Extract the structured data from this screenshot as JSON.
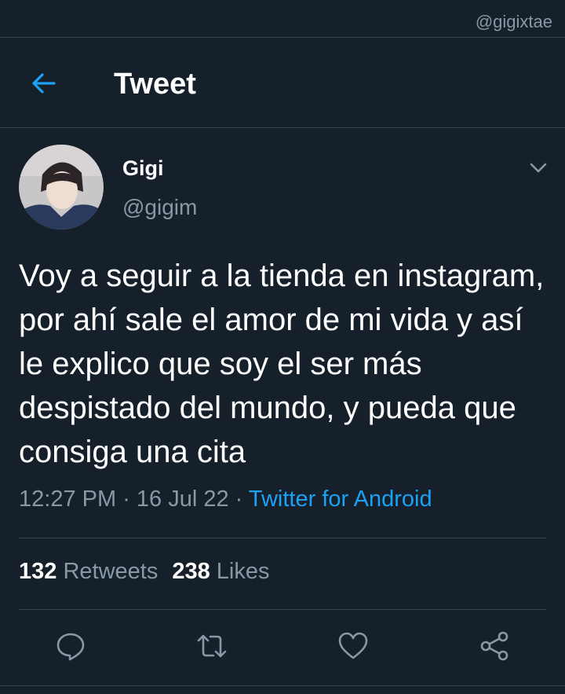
{
  "watermark": "@gigixtae",
  "header": {
    "title": "Tweet",
    "back_icon": "arrow-left-icon"
  },
  "tweet": {
    "author": {
      "display_name": "Gigi",
      "handle": "@gigim"
    },
    "text": "Voy a seguir a la tienda en instagram, por ahí sale el amor de mi vida y así le explico que soy el ser más despistado del mundo, y pueda que consiga una cita",
    "time": "12:27 PM",
    "date": "16 Jul 22",
    "separator": " · ",
    "source": "Twitter for Android",
    "retweets_count": "132",
    "retweets_label": "Retweets",
    "likes_count": "238",
    "likes_label": "Likes"
  },
  "actions": [
    "reply-icon",
    "retweet-icon",
    "like-icon",
    "share-icon"
  ],
  "colors": {
    "background": "#15202b",
    "divider": "#38444d",
    "secondary_text": "#8899a6",
    "accent": "#1da1f2"
  }
}
